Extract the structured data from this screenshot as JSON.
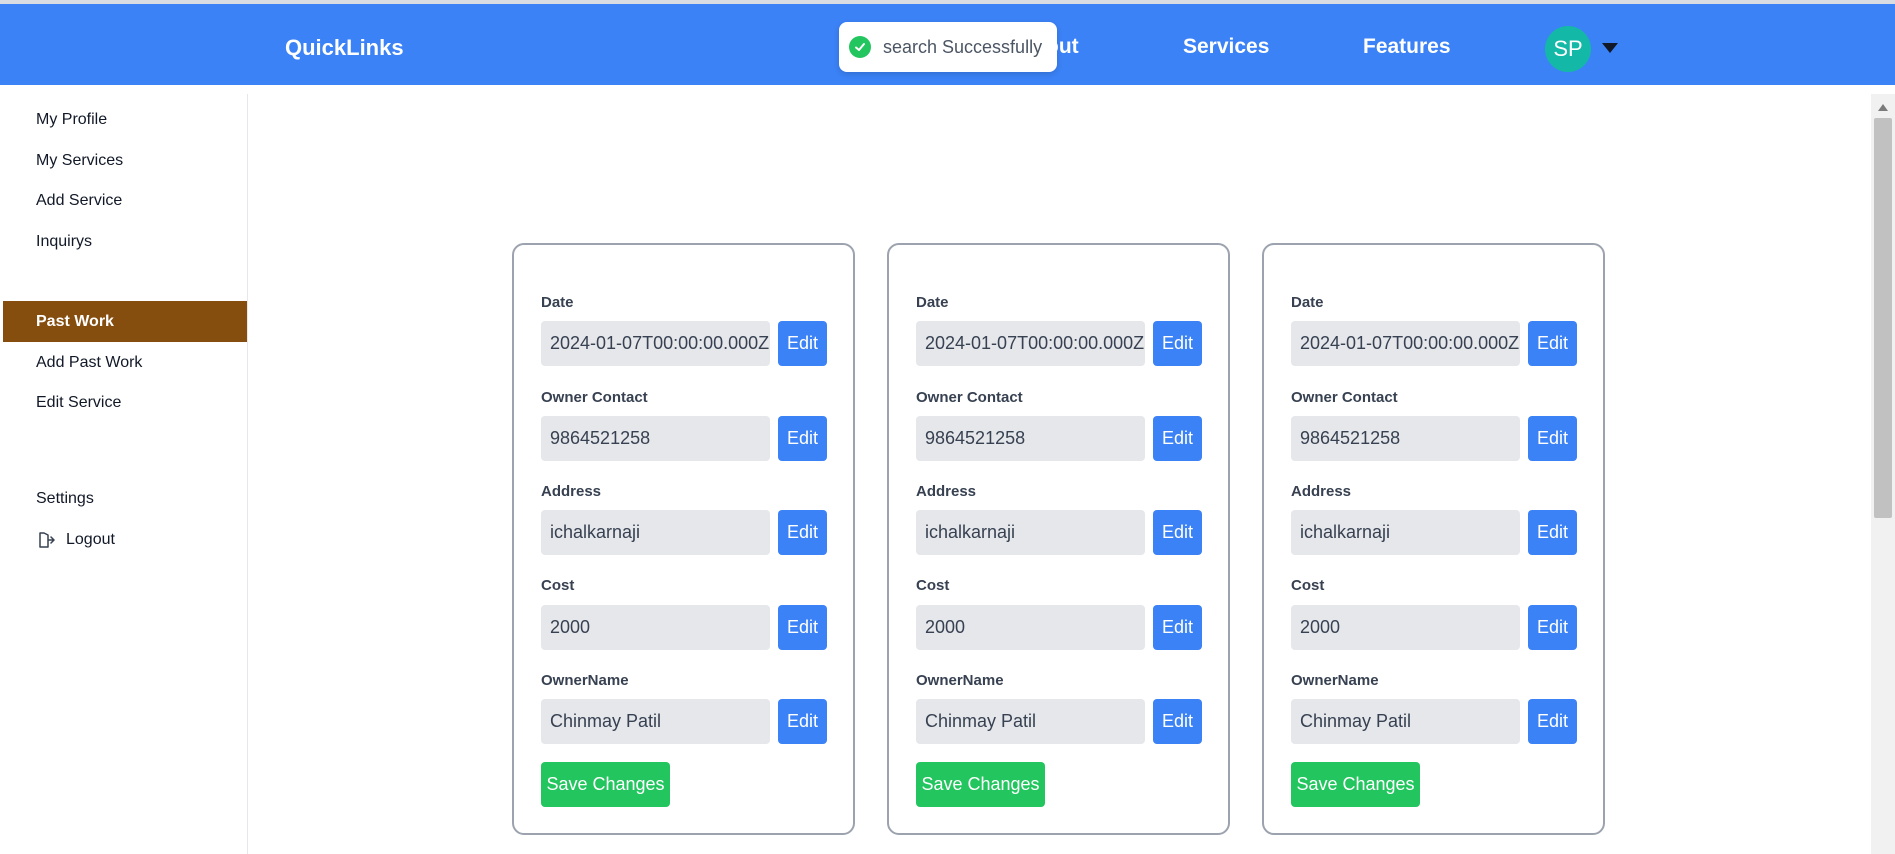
{
  "navbar": {
    "brand": "QuickLinks",
    "links": [
      "out",
      "Services",
      "Features"
    ],
    "avatar_initials": "SP"
  },
  "toast": {
    "message": "search Successfully"
  },
  "sidebar": {
    "items": [
      {
        "label": "My Profile"
      },
      {
        "label": "My Services"
      },
      {
        "label": "Add Service"
      },
      {
        "label": "Inquirys"
      },
      {
        "label": "Past Work",
        "active": true
      },
      {
        "label": "Add Past Work"
      },
      {
        "label": "Edit Service"
      },
      {
        "label": "Settings"
      },
      {
        "label": "Logout"
      }
    ]
  },
  "cards": [
    {
      "fields": [
        {
          "label": "Date",
          "value": "2024-01-07T00:00:00.000Z",
          "button": "Edit"
        },
        {
          "label": "Owner Contact",
          "value": "9864521258",
          "button": "Edit"
        },
        {
          "label": "Address",
          "value": "ichalkarnaji",
          "button": "Edit"
        },
        {
          "label": "Cost",
          "value": "2000",
          "button": "Edit"
        },
        {
          "label": "OwnerName",
          "value": "Chinmay Patil",
          "button": "Edit"
        }
      ],
      "save_label": "Save Changes"
    },
    {
      "fields": [
        {
          "label": "Date",
          "value": "2024-01-07T00:00:00.000Z",
          "button": "Edit"
        },
        {
          "label": "Owner Contact",
          "value": "9864521258",
          "button": "Edit"
        },
        {
          "label": "Address",
          "value": "ichalkarnaji",
          "button": "Edit"
        },
        {
          "label": "Cost",
          "value": "2000",
          "button": "Edit"
        },
        {
          "label": "OwnerName",
          "value": "Chinmay Patil",
          "button": "Edit"
        }
      ],
      "save_label": "Save Changes"
    },
    {
      "fields": [
        {
          "label": "Date",
          "value": "2024-01-07T00:00:00.000Z",
          "button": "Edit"
        },
        {
          "label": "Owner Contact",
          "value": "9864521258",
          "button": "Edit"
        },
        {
          "label": "Address",
          "value": "ichalkarnaji",
          "button": "Edit"
        },
        {
          "label": "Cost",
          "value": "2000",
          "button": "Edit"
        },
        {
          "label": "OwnerName",
          "value": "Chinmay Patil",
          "button": "Edit"
        }
      ],
      "save_label": "Save Changes"
    }
  ],
  "colors": {
    "navbar": "#3b82f6",
    "active_sidebar": "#854d0e",
    "edit_button": "#3b82f6",
    "save_button": "#22c55e",
    "avatar": "#14b8a6",
    "toast_check": "#22c55e"
  },
  "icons": [
    "check-circle-icon",
    "chevron-down-icon",
    "logout-icon"
  ]
}
